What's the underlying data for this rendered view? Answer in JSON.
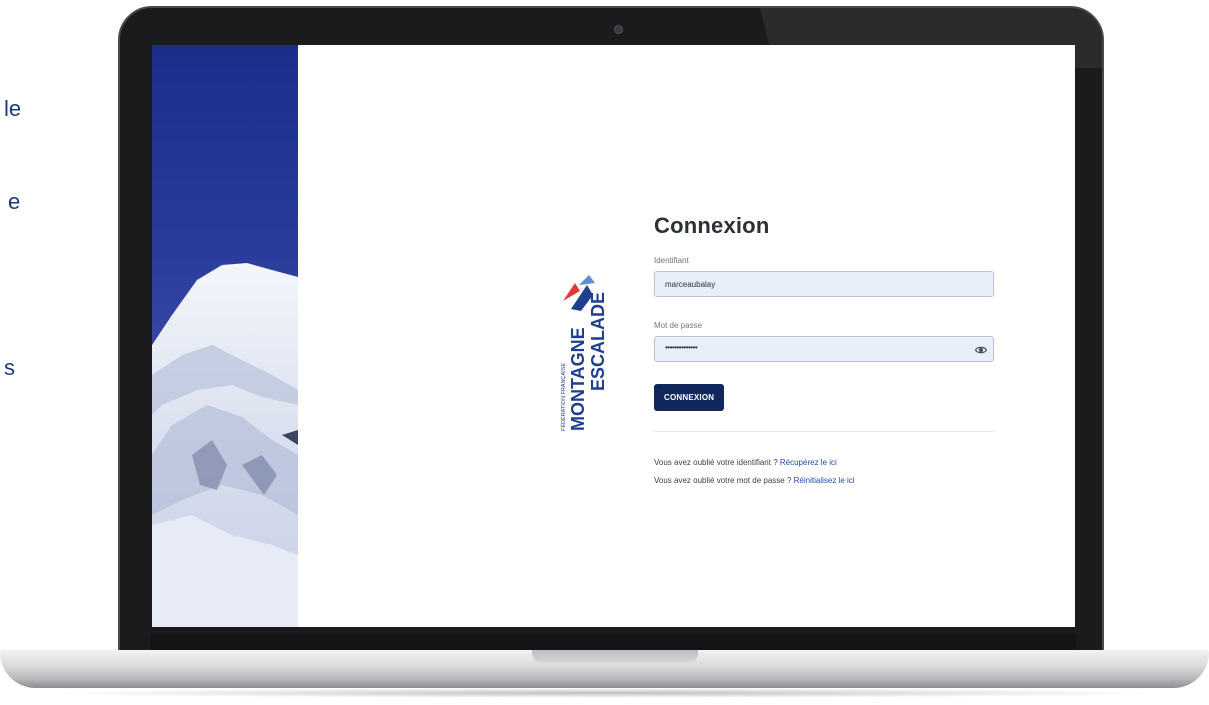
{
  "page_fragments": [
    "le",
    "e",
    "s"
  ],
  "login": {
    "title": "Connexion",
    "username_label": "Identifiant",
    "username_value": "marceaubalay",
    "password_label": "Mot de passe",
    "password_value": "••••••••••••••",
    "submit_label": "CONNEXION",
    "forgot_id_text": "Vous avez oublié votre identifiant ?",
    "forgot_id_link": "Récupérez le ici",
    "forgot_pwd_text": "Vous avez oublié votre mot de passe ?",
    "forgot_pwd_link": "Réinitialisez le ici"
  },
  "logo": {
    "line1": "FÉDÉRATION FRANÇAISE",
    "line2": "MONTAGNE",
    "line3": "ESCALADE",
    "colors": {
      "blue": "#1f3e8c",
      "red": "#e4393b",
      "light_blue": "#5b8fd0"
    }
  },
  "colors": {
    "primary": "#11285d",
    "field_bg": "#e8effb",
    "link": "#1d4ea3",
    "hero_sky": "#1c2d8a"
  },
  "icons": {
    "password_toggle": "eye-icon"
  }
}
